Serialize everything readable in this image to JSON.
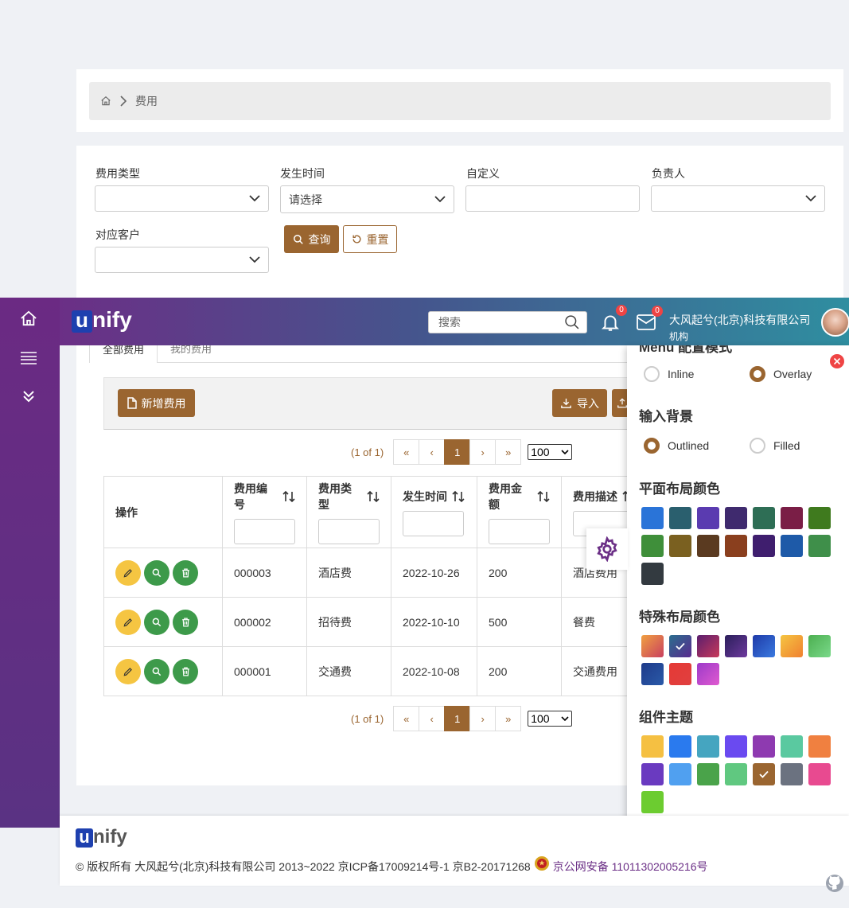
{
  "breadcrumb": {
    "current": "费用"
  },
  "filters": {
    "expense_type": {
      "label": "费用类型",
      "value": ""
    },
    "occur_time": {
      "label": "发生时间",
      "value": "请选择"
    },
    "custom": {
      "label": "自定义",
      "value": ""
    },
    "owner": {
      "label": "负责人",
      "value": ""
    },
    "customer": {
      "label": "对应客户",
      "value": ""
    },
    "query_label": "查询",
    "reset_label": "重置"
  },
  "header": {
    "logo_letter": "u",
    "logo_rest": "nify",
    "search_placeholder": "搜索",
    "notifications_count": "0",
    "messages_count": "0",
    "company": "大风起兮(北京)科技有限公司",
    "org_label": "机构"
  },
  "tabs": [
    {
      "label": "全部费用",
      "active": true
    },
    {
      "label": "我的费用",
      "active": false
    }
  ],
  "toolbar": {
    "add_label": "新增费用",
    "import_label": "导入"
  },
  "pagination": {
    "summary": "(1 of 1)",
    "first": "«",
    "prev": "‹",
    "page": "1",
    "next": "›",
    "last": "»",
    "rows_per_page": "100"
  },
  "table": {
    "headers": {
      "actions": "操作",
      "code": "费用编号",
      "type": "费用类型",
      "time": "发生时间",
      "amount": "费用金额",
      "desc": "费用描述"
    },
    "rows": [
      {
        "code": "000003",
        "type": "酒店费",
        "time": "2022-10-26",
        "amount": "200",
        "desc": "酒店费用"
      },
      {
        "code": "000002",
        "type": "招待费",
        "time": "2022-10-10",
        "amount": "500",
        "desc": "餐费"
      },
      {
        "code": "000001",
        "type": "交通费",
        "time": "2022-10-08",
        "amount": "200",
        "desc": "交通费用"
      }
    ]
  },
  "config_panel": {
    "menu_mode_title": "Menu 配置模式",
    "menu_modes": [
      {
        "label": "Inline",
        "selected": false
      },
      {
        "label": "Overlay",
        "selected": true
      }
    ],
    "input_bg_title": "输入背景",
    "input_bgs": [
      {
        "label": "Outlined",
        "selected": true
      },
      {
        "label": "Filled",
        "selected": false
      }
    ],
    "flat_title": "平面布局颜色",
    "flat_colors": [
      "#2a74d8",
      "#2a5f6e",
      "#5a3bb0",
      "#3f2a6e",
      "#2e6e55",
      "#7a1e46",
      "#3f7a1e",
      "#3f8f3a",
      "#7a6020",
      "#5a3a20",
      "#8a3f1e",
      "#3f1e6e",
      "#1e5aa8",
      "#3f8f4a",
      "#333a40"
    ],
    "special_title": "特殊布局颜色",
    "special_colors": [
      [
        "#f0a040",
        "#c94060"
      ],
      [
        "#2a6e8e",
        "#5a2a8e"
      ],
      [
        "#5a1e6e",
        "#c93a5a"
      ],
      [
        "#2a1e5a",
        "#6e3a9e"
      ],
      [
        "#1e3aa8",
        "#3a7ae0"
      ],
      [
        "#f5c542",
        "#f08030"
      ],
      [
        "#4caf50",
        "#7ad98a"
      ],
      [
        "#1e3a8a",
        "#2a5aa8"
      ],
      [
        "#e53935",
        "#e04040"
      ],
      [
        "#9c3ac9",
        "#e05ad0"
      ]
    ],
    "special_selected": 1,
    "theme_title": "组件主题",
    "theme_colors": [
      "#f5c042",
      "#2a7aee",
      "#45a5c0",
      "#6a4af0",
      "#8e3ab0",
      "#5ac9a0",
      "#f08040",
      "#6a3ac0",
      "#50a0f0",
      "#4aa34a",
      "#60c880",
      "#9a6530",
      "#6b7280",
      "#e84a90",
      "#6ccc30"
    ],
    "theme_selected": 11
  },
  "footer": {
    "copyright": "© 版权所有 大风起兮(北京)科技有限公司 2013~2022 京ICP备17009214号-1 京B2-20171268",
    "police": "京公网安备 11011302005216号"
  }
}
